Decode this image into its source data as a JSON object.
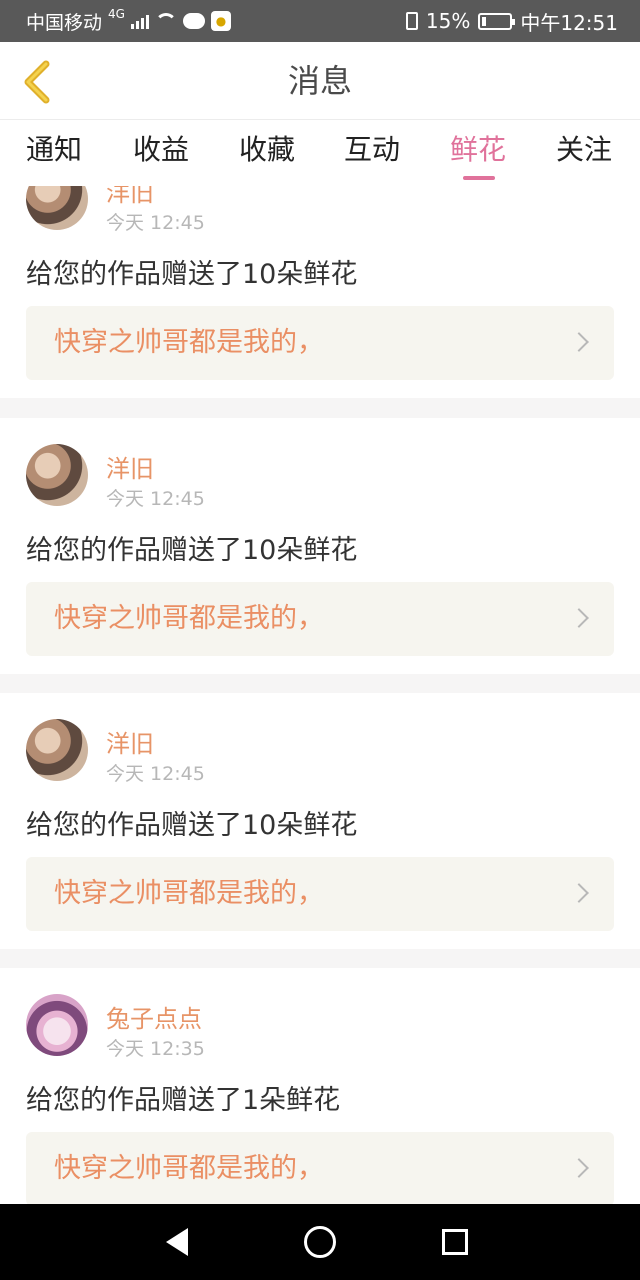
{
  "status_bar": {
    "carrier": "中国移动",
    "network": "4G",
    "battery_percent": "15%",
    "battery_level": 0.15,
    "time": "中午12:51",
    "icons": [
      "signal-icon",
      "wifi-icon",
      "glasses-icon",
      "app-badge-icon",
      "vibrate-icon",
      "battery-icon"
    ]
  },
  "header": {
    "back_icon": "chevron-left-icon",
    "title": "消息"
  },
  "tabs": [
    {
      "label": "通知"
    },
    {
      "label": "收益"
    },
    {
      "label": "收藏"
    },
    {
      "label": "互动"
    },
    {
      "label": "鲜花",
      "active": true
    },
    {
      "label": "关注"
    }
  ],
  "messages": [
    {
      "user": "洋旧",
      "time": "今天 12:45",
      "text": "给您的作品赠送了10朵鲜花",
      "work": "快穿之帅哥都是我的，"
    },
    {
      "user": "洋旧",
      "time": "今天 12:45",
      "text": "给您的作品赠送了10朵鲜花",
      "work": "快穿之帅哥都是我的，"
    },
    {
      "user": "洋旧",
      "time": "今天 12:45",
      "text": "给您的作品赠送了10朵鲜花",
      "work": "快穿之帅哥都是我的，"
    },
    {
      "user": "兔子点点",
      "time": "今天 12:35",
      "text": "给您的作品赠送了1朵鲜花",
      "work": "快穿之帅哥都是我的，"
    }
  ],
  "system_nav": {
    "icons": [
      "back-triangle-icon",
      "home-circle-icon",
      "recent-square-icon"
    ]
  },
  "colors": {
    "accent": "#e0729b",
    "username": "#e79467",
    "work_title": "#ea8f64",
    "status_bar": "#595959"
  }
}
